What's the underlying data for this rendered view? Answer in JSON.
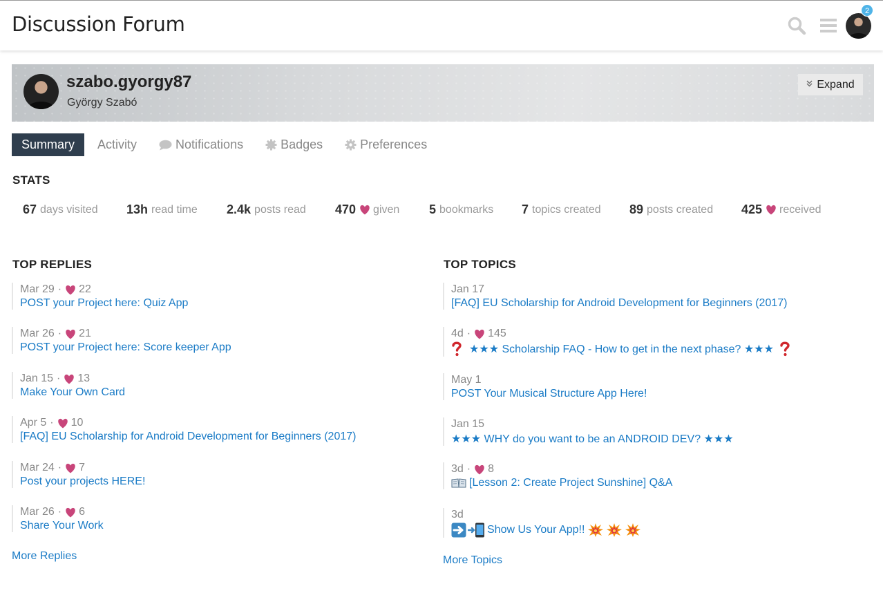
{
  "header": {
    "site_title": "Discussion Forum",
    "notification_count": "2",
    "icons": [
      "search-icon",
      "hamburger-menu-icon",
      "user-avatar"
    ]
  },
  "profile": {
    "username": "szabo.gyorgy87",
    "full_name": "György Szabó",
    "expand_label": "Expand"
  },
  "tabs": [
    {
      "label": "Summary",
      "active": true,
      "icon": ""
    },
    {
      "label": "Activity",
      "active": false,
      "icon": ""
    },
    {
      "label": "Notifications",
      "active": false,
      "icon": "comment-icon"
    },
    {
      "label": "Badges",
      "active": false,
      "icon": "badge-icon"
    },
    {
      "label": "Preferences",
      "active": false,
      "icon": "gear-icon"
    }
  ],
  "stats": {
    "heading": "STATS",
    "items": [
      {
        "value": "67",
        "label": "days visited"
      },
      {
        "value": "13h",
        "label": "read time"
      },
      {
        "value": "2.4k",
        "label": "posts read"
      },
      {
        "value": "470",
        "label": "given",
        "heart": true
      },
      {
        "value": "5",
        "label": "bookmarks"
      },
      {
        "value": "7",
        "label": "topics created"
      },
      {
        "value": "89",
        "label": "posts created"
      },
      {
        "value": "425",
        "label": "received",
        "heart": true
      }
    ]
  },
  "top_replies": {
    "heading": "TOP REPLIES",
    "items": [
      {
        "date": "Mar 29",
        "likes": "22",
        "title": "POST your Project here: Quiz App"
      },
      {
        "date": "Mar 26",
        "likes": "21",
        "title": "POST your Project here: Score keeper App"
      },
      {
        "date": "Jan 15",
        "likes": "13",
        "title": "Make Your Own Card"
      },
      {
        "date": "Apr 5",
        "likes": "10",
        "title": "[FAQ] EU Scholarship for Android Development for Beginners (2017)"
      },
      {
        "date": "Mar 24",
        "likes": "7",
        "title": "Post your projects HERE!"
      },
      {
        "date": "Mar 26",
        "likes": "6",
        "title": "Share Your Work"
      }
    ],
    "more_label": "More Replies"
  },
  "top_topics": {
    "heading": "TOP TOPICS",
    "items": [
      {
        "date": "Jan 17",
        "likes": "",
        "title": "[FAQ] EU Scholarship for Android Development for Beginners (2017)"
      },
      {
        "date": "4d",
        "likes": "145",
        "title": "★★★ Scholarship FAQ - How to get in the next phase? ★★★"
      },
      {
        "date": "May 1",
        "likes": "",
        "title": "POST Your Musical Structure App Here!"
      },
      {
        "date": "Jan 15",
        "likes": "",
        "title": "★★★ WHY do you want to be an ANDROID DEV? ★★★"
      },
      {
        "date": "3d",
        "likes": "8",
        "title": "[Lesson 2: Create Project Sunshine] Q&A"
      },
      {
        "date": "3d",
        "likes": "",
        "title": "Show Us Your App!!"
      }
    ],
    "more_label": "More Topics"
  },
  "colors": {
    "accent_link": "#1a7bc6",
    "heart": "#c8457a",
    "active_tab_bg": "#2f3e4e",
    "badge": "#4fb4e8"
  }
}
